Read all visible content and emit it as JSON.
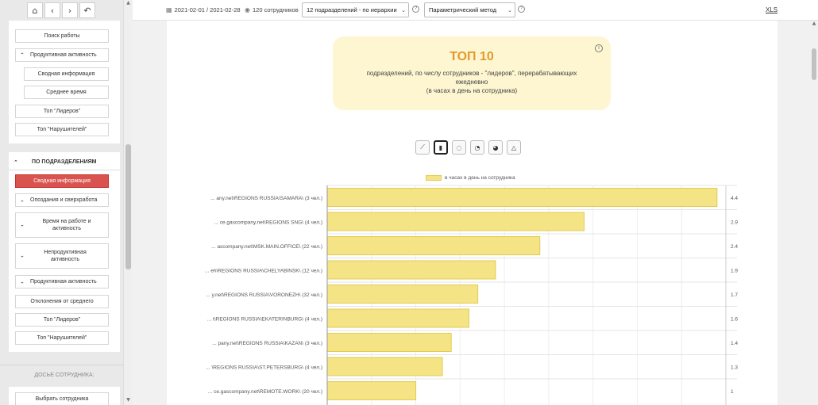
{
  "nav": {
    "home_icon": "home-icon",
    "back_icon": "chevron-left-icon",
    "forward_icon": "chevron-right-icon",
    "undo_icon": "undo-icon"
  },
  "sidebar": {
    "panel1": {
      "job_search": "Поиск работы",
      "productive_activity": "Продуктивная активность",
      "summary": "Сводная информация",
      "avg_time": "Среднее время",
      "top_leaders": "Топ \"Лидеров\"",
      "top_violators": "Топ \"Нарушителей\""
    },
    "panel2": {
      "section_title": "ПО ПОДРАЗДЕЛЕНИЯМ",
      "summary": "Сводная информация",
      "late_overtime": "Опоздания и сверхработа",
      "time_at_work": "Время на работе и активность",
      "unproductive": "Непродуктивная активность",
      "productive": "Продуктивная активность",
      "deviations": "Отклонения от среднего",
      "top_leaders": "Топ \"Лидеров\"",
      "top_violators": "Топ \"Нарушителей\""
    },
    "dossier_title": "ДОСЬЕ СОТРУДНИКА:",
    "select_employee": "Выбрать сотрудника"
  },
  "topbar": {
    "date_range": "2021-02-01 / 2021-02-28",
    "employees": "120 сотрудников",
    "dept_select": "12 подразделений - по иерархии",
    "method_select": "Параметрический метод",
    "xls": "XLS"
  },
  "topbox": {
    "title": "ТОП 10",
    "line1": "подразделений, по числу сотрудников - \"лидеров\", перерабатывающих ежедневно",
    "line2": "(в часах в день на сотрудника)"
  },
  "chart_types": [
    "line-chart-icon",
    "bar-chart-icon",
    "donut-chart-icon",
    "pie-chart-icon",
    "polar-chart-icon",
    "radar-chart-icon"
  ],
  "colors": {
    "accent": "#d9534f",
    "bar": "#f4e486",
    "bar_border": "#e3cb53",
    "title": "#e39a2d",
    "box": "#fdf6d1"
  },
  "chart_data": {
    "type": "bar",
    "orientation": "horizontal",
    "categories": [
      "... any.net\\REGIONS RUSSIA\\SAMARA\\ (3 чел.)",
      "... ce.gascompany.net\\REGIONS SNG\\ (4 чел.)",
      "... ascompany.net\\MSK.MAIN.OFFICE\\ (22 чел.)",
      "... eh\\REGIONS RUSSIA\\CHELYABINSK\\ (12 чел.)",
      "... y.net\\REGIONS RUSSIA\\VORONEZH\\ (32 чел.)",
      "... t\\REGIONS RUSSIA\\EKATERINBURG\\ (4 чел.)",
      "... pany.net\\REGIONS RUSSIA\\KAZAN\\ (3 чел.)",
      "... \\REGIONS RUSSIA\\ST.PETERSBURG\\ (4 чел.)",
      "... ce.gascompany.net\\REMOTE.WORK\\ (20 чел.)"
    ],
    "values": [
      4.4,
      2.9,
      2.4,
      1.9,
      1.7,
      1.6,
      1.4,
      1.3,
      1
    ],
    "value_labels": [
      "4.4",
      "2.9",
      "2.4",
      "1.9",
      "1.7",
      "1.6",
      "1.4",
      "1.3",
      "1"
    ],
    "series": [
      {
        "name": "в часах в день на сотрудника",
        "values": [
          4.4,
          2.9,
          2.4,
          1.9,
          1.7,
          1.6,
          1.4,
          1.3,
          1
        ]
      }
    ],
    "xlim": [
      0,
      4.5
    ],
    "grid": true,
    "legend": "top-center"
  }
}
